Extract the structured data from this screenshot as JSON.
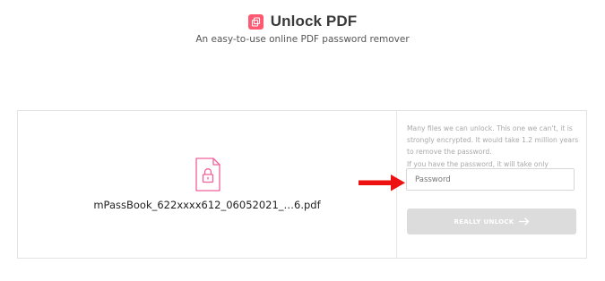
{
  "header": {
    "title": "Unlock PDF",
    "subtitle": "An easy-to-use online PDF password remover",
    "logo_icon": "unlock-logo-icon",
    "accent_color": "#ff5a72"
  },
  "file": {
    "icon": "locked-file-icon",
    "name": "mPassBook_622xxxx612_06052021_…6.pdf"
  },
  "unlock_panel": {
    "message_lines": [
      "Many files we can unlock. This one we can't, it is",
      "strongly encrypted. It would take 1.2 million years",
      "to remove the password.",
      "If you have the password, it will take only seconds:"
    ],
    "password_placeholder": "Password",
    "password_value": "",
    "button_label": "REALLY UNLOCK",
    "button_icon": "arrow-right-icon"
  },
  "annotation": {
    "icon": "red-arrow-icon",
    "color": "#ee1111"
  }
}
